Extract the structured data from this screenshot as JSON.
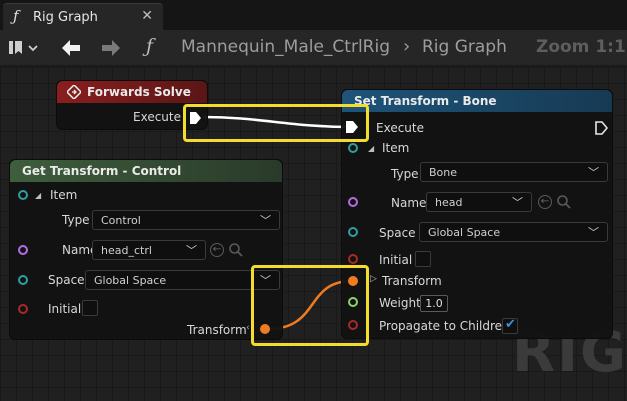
{
  "tab": {
    "fn_glyph": "ƒ",
    "title": "Rig Graph",
    "close": "✕"
  },
  "toolbar": {
    "back": "🡐",
    "forward": "🡒",
    "fn_glyph": "ƒ",
    "crumb_asset": "Mannequin_Male_CtrlRig",
    "crumb_sep": "›",
    "crumb_graph": "Rig Graph",
    "zoom": "Zoom 1:1"
  },
  "watermark": "RIG",
  "nodes": {
    "forwards_solve": {
      "title": "Forwards Solve",
      "execute_label": "Execute"
    },
    "get_control": {
      "title": "Get Transform - Control",
      "item_label": "Item",
      "type_label": "Type",
      "type_value": "Control",
      "name_label": "Name",
      "name_value": "head_ctrl",
      "space_label": "Space",
      "space_value": "Global Space",
      "initial_label": "Initial",
      "transform_label": "Transform"
    },
    "set_bone": {
      "title": "Set Transform - Bone",
      "execute_label": "Execute",
      "item_label": "Item",
      "type_label": "Type",
      "type_value": "Bone",
      "name_label": "Name",
      "name_value": "head",
      "space_label": "Space",
      "space_value": "Global Space",
      "initial_label": "Initial",
      "transform_label": "Transform",
      "weight_label": "Weight",
      "weight_value": "1.0",
      "propagate_label": "Propagate to Children",
      "propagate_checked": true
    }
  },
  "colors": {
    "highlight": "#f3dc2b",
    "exec_wire": "#ffffff",
    "transform_wire": "#f07c22",
    "execute_header": "#8a1e1e",
    "get_header": "#3e5e3c",
    "set_header": "#1d5479"
  }
}
